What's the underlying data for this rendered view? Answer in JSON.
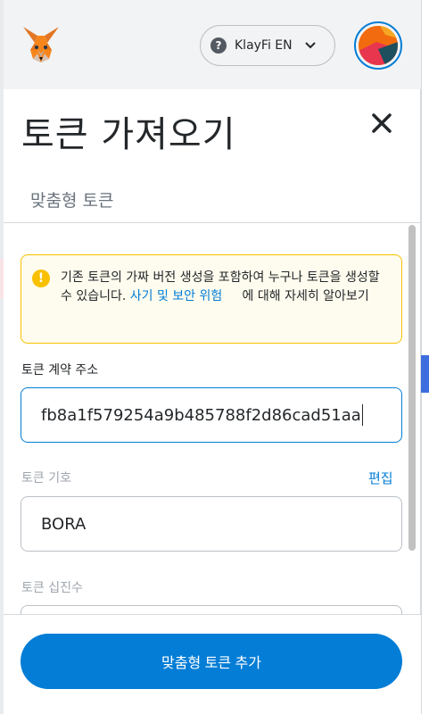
{
  "header": {
    "logo_icon": "metamask-fox-icon",
    "network": {
      "label": "KlayFi EN",
      "help_icon": "question-circle-icon",
      "dropdown_icon": "chevron-down-icon"
    },
    "account_icon": "account-avatar-icon"
  },
  "page": {
    "title": "토큰 가져오기",
    "close_icon": "close-icon",
    "tab_label": "맞춤형 토큰"
  },
  "warning": {
    "icon": "info-icon",
    "text_before": "기존 토큰의 가짜 버전 생성을 포함하여 누구나 토큰을 생성할 수 있습니다.",
    "link_text": "사기 및 보안 위험",
    "text_after": "에 대해 자세히 알아보기"
  },
  "form": {
    "contract_address": {
      "label": "토큰 계약 주소",
      "value": "fb8a1f579254a9b485788f2d86cad51aa"
    },
    "symbol": {
      "label": "토큰 기호",
      "edit_label": "편집",
      "value": "BORA"
    },
    "decimals": {
      "label": "토큰 십진수",
      "value": ""
    }
  },
  "footer": {
    "primary_button": "맞춤형 토큰 추가"
  },
  "colors": {
    "primary": "#037dd6",
    "warning_border": "#f8c000",
    "warning_bg": "#fefcee",
    "header_bg": "#f2f3f4"
  }
}
